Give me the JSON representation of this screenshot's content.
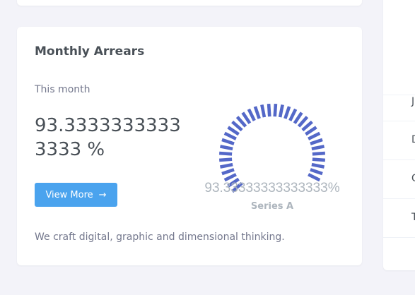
{
  "card": {
    "title": "Monthly Arrears",
    "period_label": "This month",
    "value": "93.33333333333333 %",
    "button_label": "View More",
    "description": "We craft digital, graphic and dimensional thinking."
  },
  "gauge": {
    "value_label": "93.33333333333333%",
    "series_name": "Series A",
    "percent": 93.33333333333333,
    "color": "#5468c8"
  },
  "right_panel": {
    "rows": [
      {
        "letter": "J"
      },
      {
        "letter": "D"
      },
      {
        "letter": "G"
      },
      {
        "letter": "T"
      }
    ]
  },
  "colors": {
    "background": "#f3f3f9",
    "card": "#ffffff",
    "button": "#4aa3ee",
    "text_dark": "#495057",
    "text_muted": "#74788d",
    "gauge_label": "#adb5bd"
  }
}
